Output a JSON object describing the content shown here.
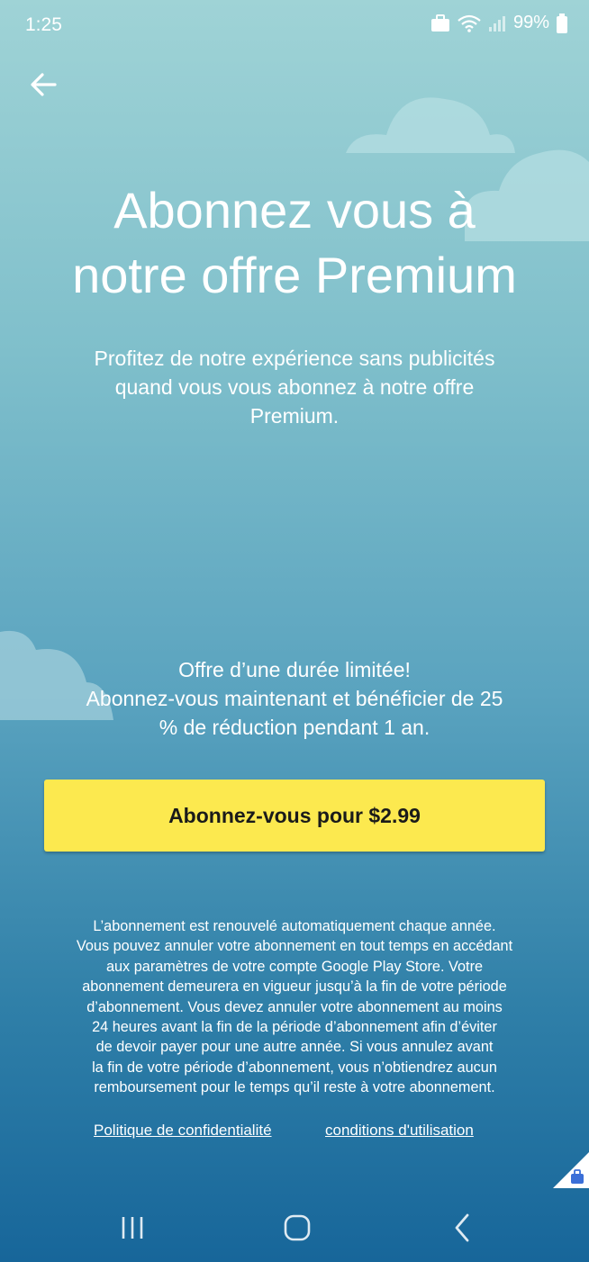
{
  "status_bar": {
    "time": "1:25",
    "battery_percent": "99%",
    "icons": [
      "briefcase-icon",
      "wifi-icon",
      "signal-icon",
      "battery-icon"
    ]
  },
  "nav": {
    "back_icon": "arrow-left-icon"
  },
  "title_lines": [
    "Abonnez vous à",
    "notre offre Premium"
  ],
  "subtitle_lines": [
    "Profitez de notre expérience sans publicités",
    "quand vous vous abonnez à notre offre",
    "Premium."
  ],
  "offer_lines": [
    "Offre d’une durée limitée!",
    "Abonnez-vous maintenant et bénéficier de 25",
    "% de réduction pendant 1 an."
  ],
  "cta_label": "Abonnez-vous pour $2.99",
  "legal_lines": [
    "L’abonnement est renouvelé automatiquement chaque année.",
    "Vous pouvez annuler votre abonnement en tout temps en accédant",
    "aux paramètres de votre compte Google Play Store. Votre",
    "abonnement demeurera en vigueur jusqu’à la fin de votre période",
    "d’abonnement. Vous devez annuler votre abonnement au moins",
    "24 heures avant la fin de la période d’abonnement afin d’éviter",
    "de devoir payer pour une autre année. Si vous annulez avant",
    "la fin de votre période d’abonnement, vous n’obtiendrez aucun",
    "remboursement pour le temps qu’il reste à votre abonnement."
  ],
  "links": {
    "privacy": "Politique de confidentialité",
    "terms": "conditions d'utilisation"
  },
  "system_nav": {
    "recents_icon": "recents-icon",
    "home_icon": "home-icon",
    "back_icon": "chevron-left-icon"
  },
  "colors": {
    "cta_background": "#fce94f",
    "gradient_top": "#9fd3d6",
    "gradient_bottom": "#17669a"
  }
}
